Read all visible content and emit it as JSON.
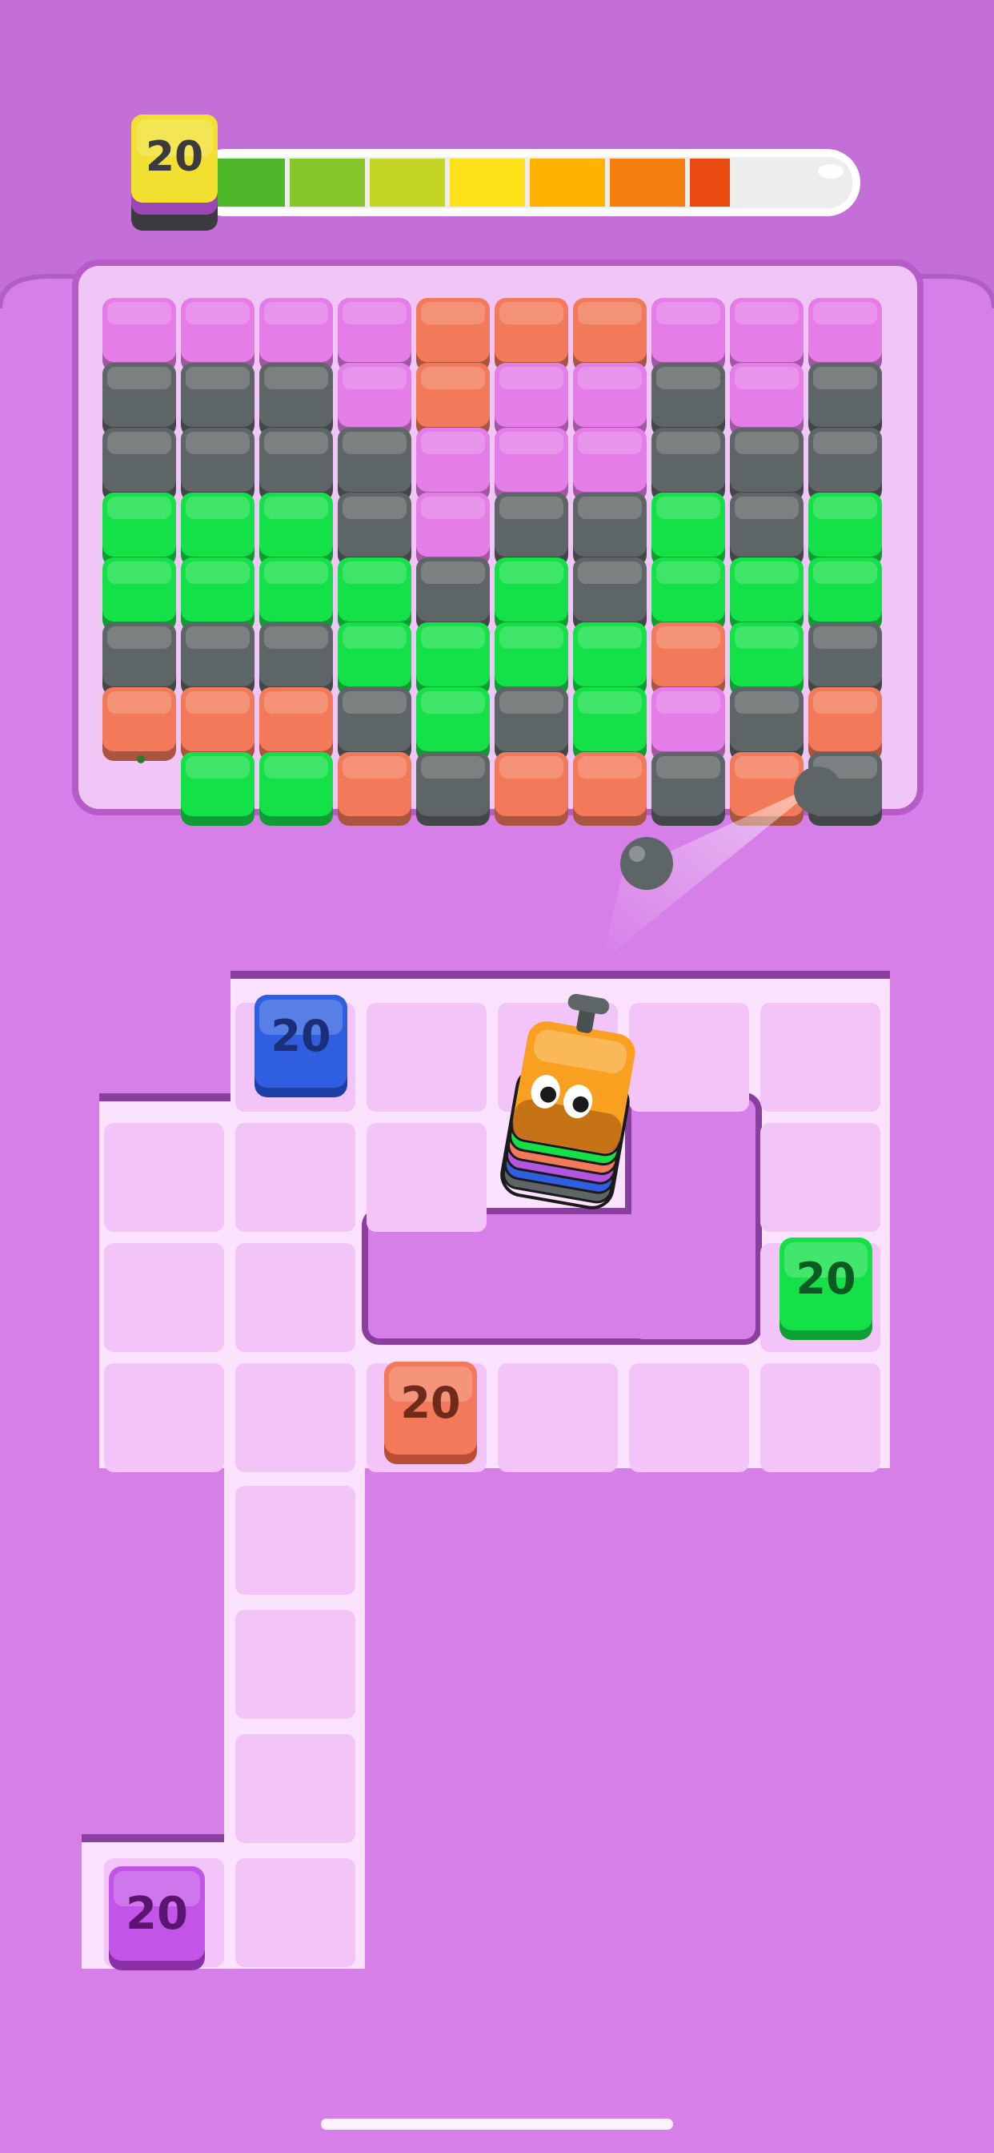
{
  "hud": {
    "level_value": "20",
    "level_cube_color": "#F2E030",
    "progress": 0.82,
    "progress_colors": [
      "#4FB82A",
      "#86C62A",
      "#C5D523",
      "#FFE21B",
      "#FFB300",
      "#F57F0F",
      "#E84A10"
    ]
  },
  "board": {
    "colors": {
      "gray": "#5E6566",
      "green": "#14E048",
      "pink": "#E57DE8",
      "coral": "#F27A5A",
      "empty": ""
    },
    "grid": [
      [
        "pink",
        "pink",
        "pink",
        "pink",
        "coral",
        "coral",
        "coral",
        "pink",
        "pink",
        "pink"
      ],
      [
        "gray",
        "gray",
        "gray",
        "pink",
        "coral",
        "pink",
        "pink",
        "gray",
        "pink",
        "gray"
      ],
      [
        "gray",
        "gray",
        "gray",
        "gray",
        "pink",
        "pink",
        "pink",
        "gray",
        "gray",
        "gray"
      ],
      [
        "green",
        "green",
        "green",
        "gray",
        "pink",
        "gray",
        "gray",
        "green",
        "gray",
        "green"
      ],
      [
        "green",
        "green",
        "green",
        "green",
        "gray",
        "green",
        "gray",
        "green",
        "green",
        "green"
      ],
      [
        "gray",
        "gray",
        "gray",
        "green",
        "green",
        "green",
        "green",
        "coral",
        "green",
        "gray"
      ],
      [
        "coral",
        "coral",
        "coral",
        "gray",
        "green",
        "gray",
        "green",
        "pink",
        "gray",
        "coral"
      ],
      [
        "empty",
        "green",
        "green",
        "coral",
        "gray",
        "coral",
        "coral",
        "gray",
        "coral",
        "gray"
      ]
    ]
  },
  "shooter": {
    "color": "#F9A020",
    "stack_colors": [
      "#5E6566",
      "#2F5FE0",
      "#B455E0",
      "#F27A5A",
      "#14E048",
      "#F27A5A"
    ]
  },
  "stacks": [
    {
      "id": "blue",
      "label": "20",
      "color": "#2F5FE0"
    },
    {
      "id": "green",
      "label": "20",
      "color": "#14E048"
    },
    {
      "id": "coral",
      "label": "20",
      "color": "#F27A5A"
    },
    {
      "id": "purple",
      "label": "20",
      "color": "#C255E8"
    }
  ]
}
